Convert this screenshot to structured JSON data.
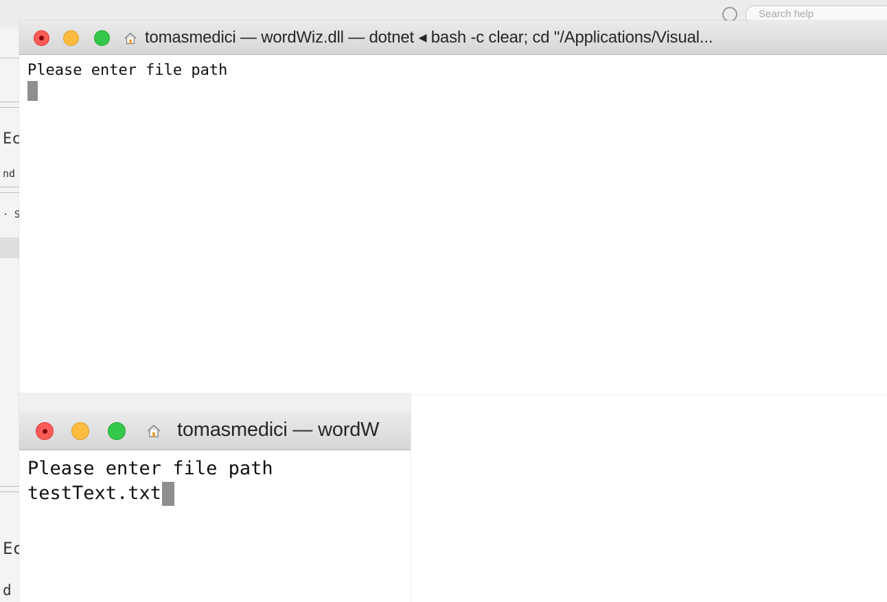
{
  "background_app": {
    "search_placeholder": "Search help",
    "fragments": [
      "Ec",
      "nd",
      "· S",
      "Ec",
      "d"
    ]
  },
  "windows": [
    {
      "title": "tomasmedici — wordWiz.dll — dotnet ◂ bash -c clear; cd \"/Applications/Visual...",
      "lines": [
        "Please enter file path"
      ],
      "input": ""
    },
    {
      "title": "tomasmedici — wordW",
      "lines": [
        "Please enter file path"
      ],
      "input": "testText.txt"
    }
  ],
  "colors": {
    "close": "#fc5b57",
    "minimize": "#fdbc40",
    "zoom": "#34c84a",
    "cursor": "#8f8f8f"
  },
  "icons": {
    "close": "close-button",
    "minimize": "minimize-button",
    "zoom": "zoom-button",
    "home": "home-icon",
    "search": "search-icon"
  }
}
